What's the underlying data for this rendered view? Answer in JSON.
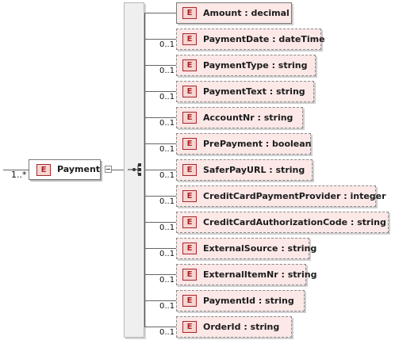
{
  "root": {
    "multiplicity": "1..*",
    "badge": "E",
    "label": "Payment"
  },
  "children": [
    {
      "badge": "E",
      "label": "Amount : decimal",
      "occurs": "",
      "optional": false
    },
    {
      "badge": "E",
      "label": "PaymentDate : dateTime",
      "occurs": "0..1",
      "optional": true
    },
    {
      "badge": "E",
      "label": "PaymentType : string",
      "occurs": "0..1",
      "optional": true
    },
    {
      "badge": "E",
      "label": "PaymentText : string",
      "occurs": "0..1",
      "optional": true
    },
    {
      "badge": "E",
      "label": "AccountNr : string",
      "occurs": "0..1",
      "optional": true
    },
    {
      "badge": "E",
      "label": "PrePayment : boolean",
      "occurs": "0..1",
      "optional": true
    },
    {
      "badge": "E",
      "label": "SaferPayURL : string",
      "occurs": "0..1",
      "optional": true
    },
    {
      "badge": "E",
      "label": "CreditCardPaymentProvider : integer",
      "occurs": "0..1",
      "optional": true
    },
    {
      "badge": "E",
      "label": "CreditCardAuthorizationCode : string",
      "occurs": "0..1",
      "optional": true
    },
    {
      "badge": "E",
      "label": "ExternalSource : string",
      "occurs": "0..1",
      "optional": true
    },
    {
      "badge": "E",
      "label": "ExternalItemNr : string",
      "occurs": "0..1",
      "optional": true
    },
    {
      "badge": "E",
      "label": "PaymentId : string",
      "occurs": "0..1",
      "optional": true
    },
    {
      "badge": "E",
      "label": "OrderId : string",
      "occurs": "0..1",
      "optional": true
    }
  ],
  "colors": {
    "element_fill": "#fbe8e7",
    "badge_border": "#a7262a",
    "badge_fill": "#f6d5d2"
  },
  "icons": {
    "collapse": "collapse-minus-icon",
    "sequence": "sequence-compositor-icon"
  }
}
